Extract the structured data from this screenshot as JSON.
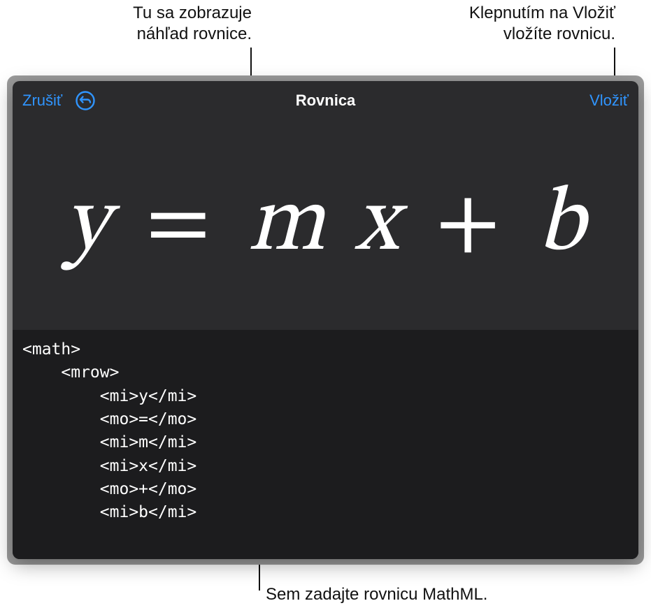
{
  "callouts": {
    "preview": "Tu sa zobrazuje\nnáhľad rovnice.",
    "insert": "Klepnutím na Vložiť\nvložíte rovnicu.",
    "input": "Sem zadajte rovnicu MathML."
  },
  "toolbar": {
    "cancel": "Zrušiť",
    "title": "Rovnica",
    "insert": "Vložiť"
  },
  "equation": {
    "y": "y",
    "eq": "=",
    "m": "m",
    "x": "x",
    "plus": "+",
    "b": "b"
  },
  "code": "<math>\n    <mrow>\n        <mi>y</mi>\n        <mo>=</mo>\n        <mi>m</mi>\n        <mi>x</mi>\n        <mo>+</mo>\n        <mi>b</mi>"
}
